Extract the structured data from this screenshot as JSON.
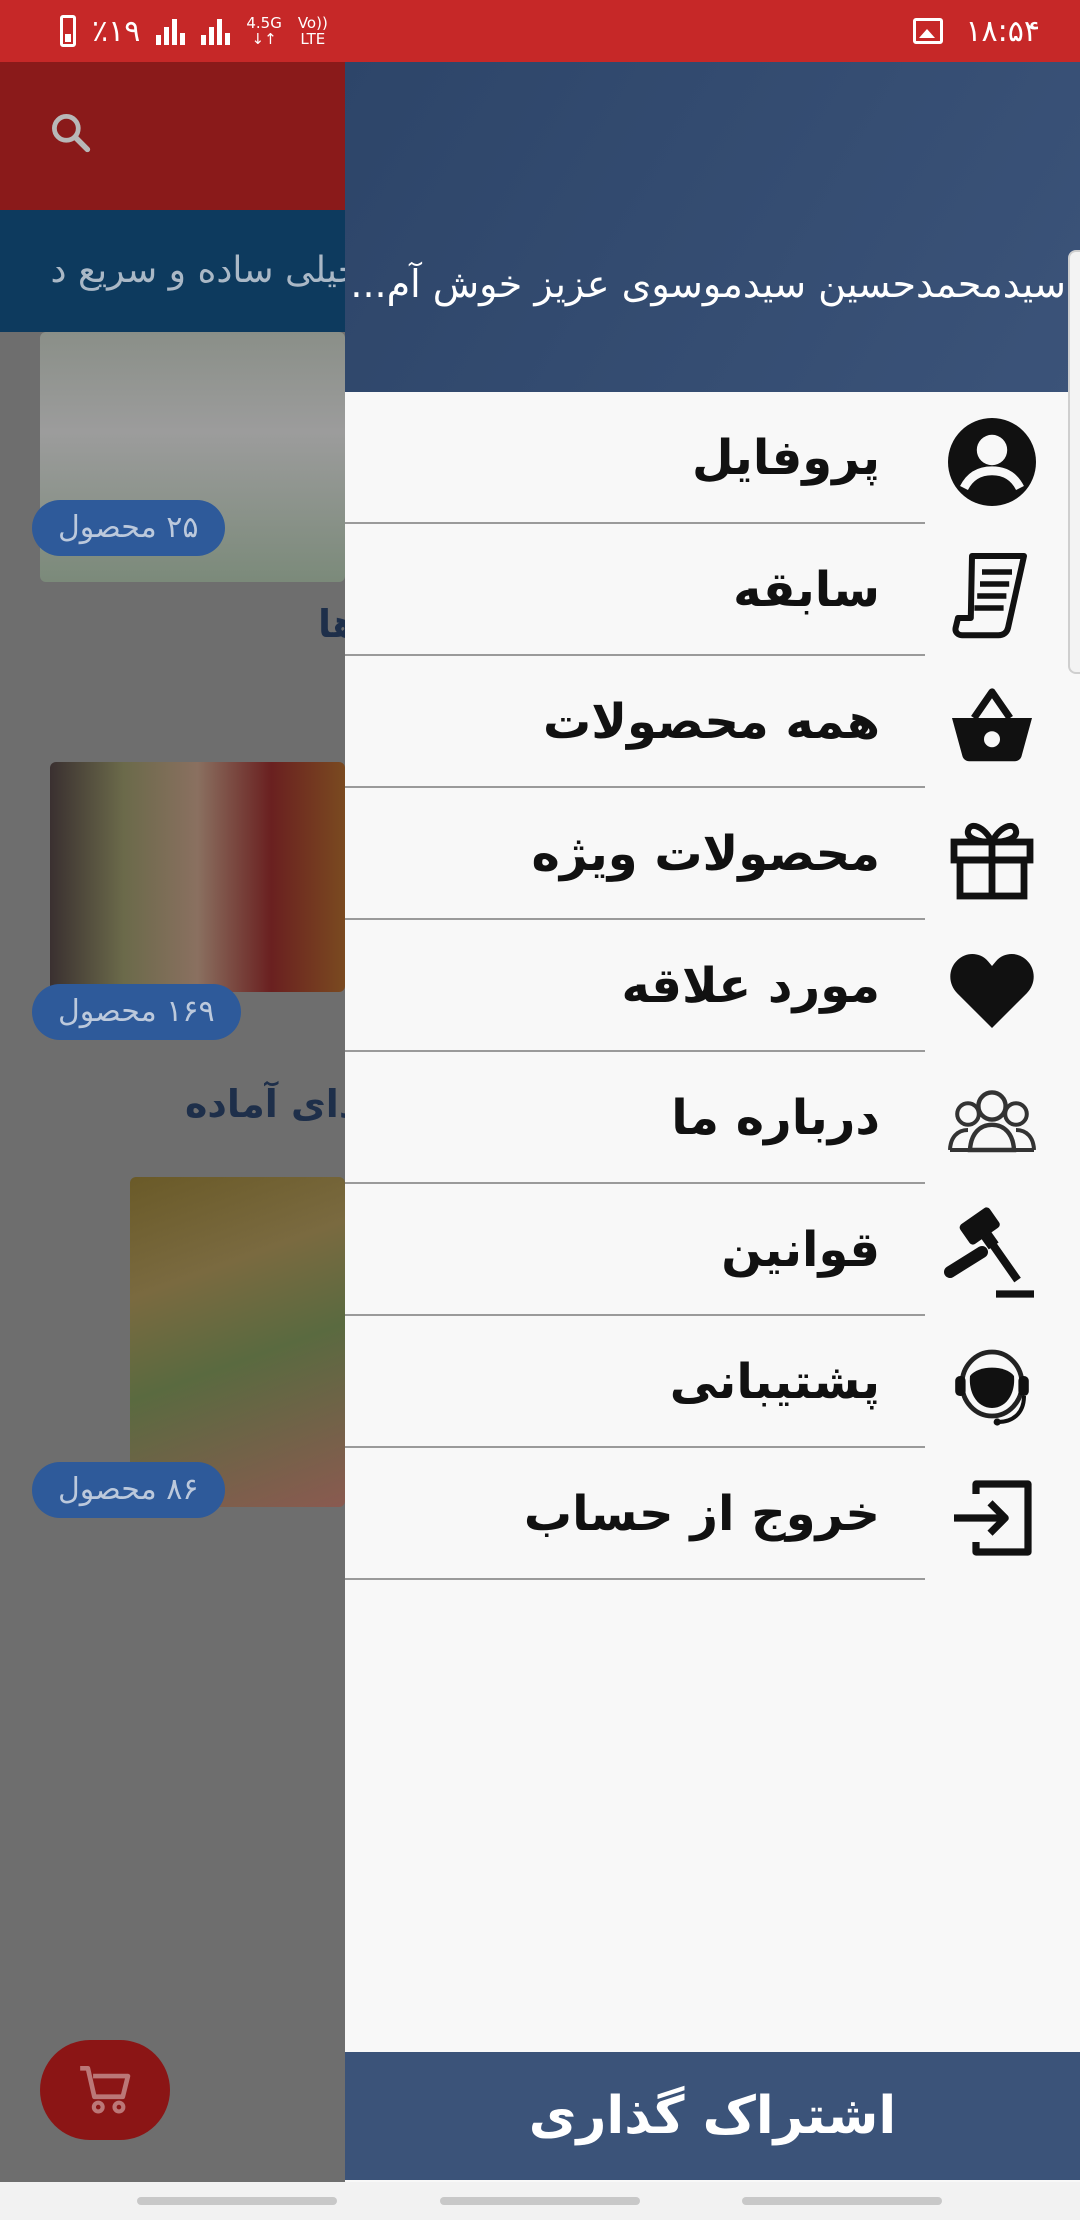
{
  "status_bar": {
    "battery": "٪۱۹",
    "network_top": "4.5G",
    "network_arrows": "↓↑",
    "volte_top": "Vo))",
    "volte_bottom": "LTE",
    "time": "۱۸:۵۴"
  },
  "background": {
    "banner_text": "خیلی ساده و سریع د",
    "categories": [
      {
        "title": "",
        "count": "۲۵ محصول"
      },
      {
        "title": "ها",
        "count": "۱۶۹ محصول"
      },
      {
        "title": "ذای آماده",
        "count": "۸۶ محصول"
      }
    ]
  },
  "drawer": {
    "greeting": "سیدمحمدحسین سیدموسوی عزیز خوش آم...",
    "items": [
      {
        "label": "پروفایل",
        "icon": "account-circle-icon"
      },
      {
        "label": "سابقه",
        "icon": "receipt-history-icon"
      },
      {
        "label": "همه محصولات",
        "icon": "shopping-basket-icon"
      },
      {
        "label": "محصولات ویژه",
        "icon": "gift-icon"
      },
      {
        "label": "مورد علاقه",
        "icon": "heart-icon"
      },
      {
        "label": "درباره ما",
        "icon": "group-users-icon"
      },
      {
        "label": "قوانین",
        "icon": "gavel-icon"
      },
      {
        "label": "پشتیبانی",
        "icon": "headset-support-icon"
      },
      {
        "label": "خروج از حساب",
        "icon": "logout-icon"
      }
    ],
    "subscribe_label": "اشتراک گذاری"
  },
  "colors": {
    "status_bar": "#c62828",
    "drawer_header": "#34496e",
    "subscribe_bar": "#3b5379",
    "badge": "#2e5a9a"
  }
}
